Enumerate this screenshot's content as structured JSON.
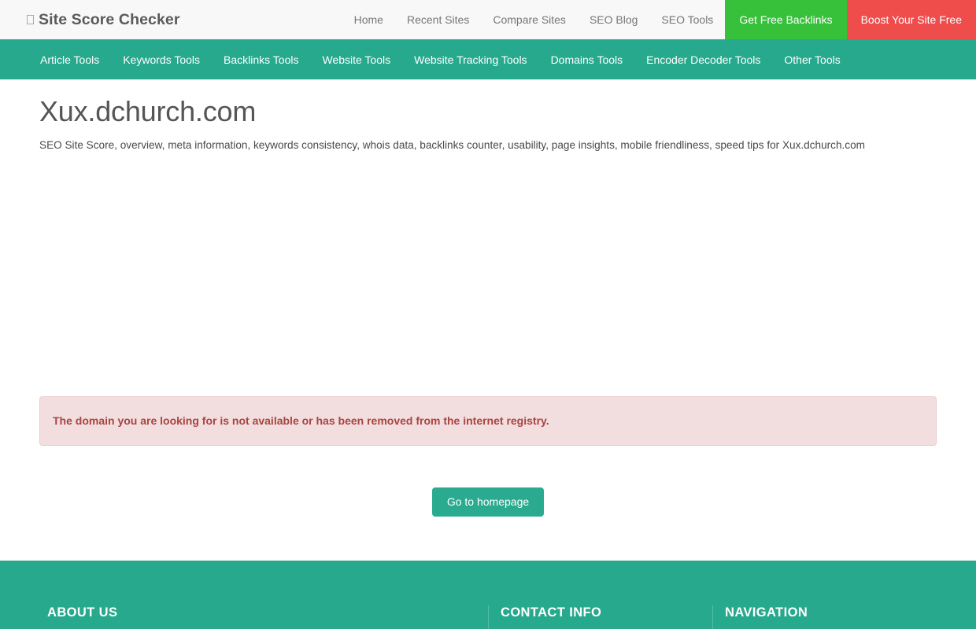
{
  "header": {
    "brand": "Site Score Checker",
    "brand_icon": "missing-glyph-icon",
    "nav": [
      {
        "label": "Home",
        "style": "plain"
      },
      {
        "label": "Recent Sites",
        "style": "plain"
      },
      {
        "label": "Compare Sites",
        "style": "plain"
      },
      {
        "label": "SEO Blog",
        "style": "plain"
      },
      {
        "label": "SEO Tools",
        "style": "plain"
      },
      {
        "label": "Get Free Backlinks",
        "style": "cta-green"
      },
      {
        "label": "Boost Your Site Free",
        "style": "cta-red"
      }
    ]
  },
  "subnav": {
    "items": [
      {
        "label": "Article Tools"
      },
      {
        "label": "Keywords Tools"
      },
      {
        "label": "Backlinks Tools"
      },
      {
        "label": "Website Tools"
      },
      {
        "label": "Website Tracking Tools"
      },
      {
        "label": "Domains Tools"
      },
      {
        "label": "Encoder Decoder Tools"
      },
      {
        "label": "Other Tools"
      }
    ]
  },
  "main": {
    "title": "Xux.dchurch.com",
    "subtitle": "SEO Site Score, overview, meta information, keywords consistency, whois data, backlinks counter, usability, page insights, mobile friendliness, speed tips for Xux.dchurch.com",
    "alert": {
      "message": "The domain you are looking for is not available or has been removed from the internet registry.",
      "text_color": "#a94442",
      "background_color": "#f2dede"
    },
    "homepage_button": "Go to homepage"
  },
  "footer": {
    "columns": [
      {
        "heading": "ABOUT US"
      },
      {
        "heading": "CONTACT INFO"
      },
      {
        "heading": "NAVIGATION"
      }
    ],
    "background_color": "#26a98c"
  },
  "colors": {
    "brand_green": "#26a98c",
    "cta_green": "#37c03a",
    "cta_red": "#ef4c4c",
    "button_green": "#2aab8f",
    "topbar_bg": "#f8f8f8"
  }
}
